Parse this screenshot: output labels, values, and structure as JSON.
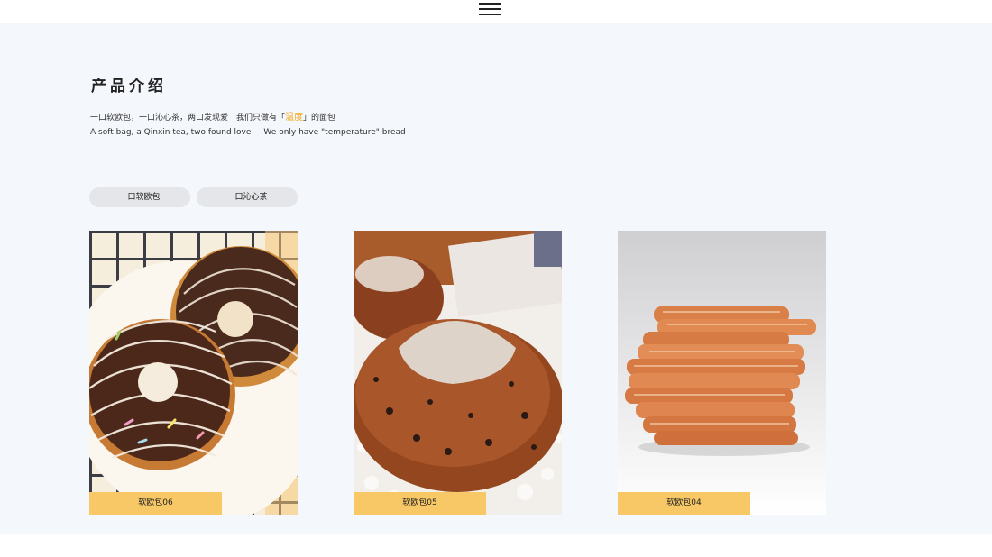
{
  "header": {
    "menu_icon": "hamburger-menu-icon"
  },
  "intro": {
    "title": "产品介绍",
    "cn_prefix": "一口软欧包，一口沁心茶，两口发现爱　我们只做有「",
    "cn_highlight": "温度",
    "cn_suffix": "」的面包",
    "en_part1": "A soft bag, a Qinxin tea, two found love",
    "en_part2": "We only have \"temperature\" bread",
    "highlight_color": "#f3a81a"
  },
  "tabs": [
    {
      "label": "一口软欧包"
    },
    {
      "label": "一口沁心茶"
    }
  ],
  "products": [
    {
      "name": "软欧包06",
      "image": "chocolate-donuts-photo"
    },
    {
      "name": "软欧包05",
      "image": "raisin-bread-photo"
    },
    {
      "name": "软欧包04",
      "image": "stacked-toast-slices-photo"
    }
  ],
  "colors": {
    "section_bg": "#f4f7fb",
    "caption_bg": "#f8c866",
    "tab_bg": "#e4e6e9"
  }
}
